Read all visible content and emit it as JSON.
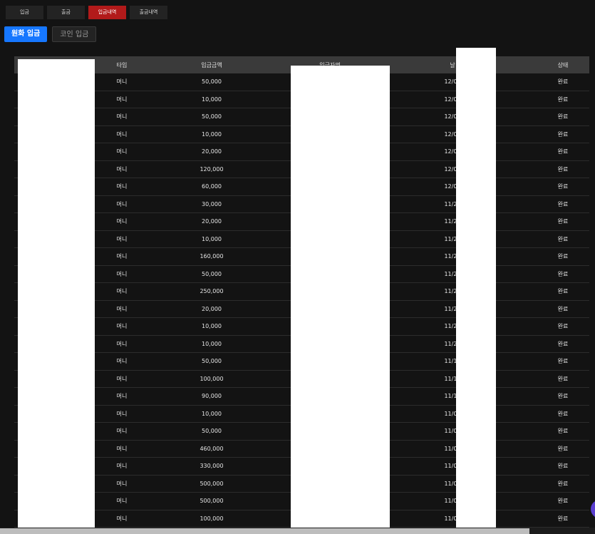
{
  "topnav": [
    {
      "label": "입금",
      "active": false
    },
    {
      "label": "출금",
      "active": false
    },
    {
      "label": "입금내역",
      "active": true
    },
    {
      "label": "출금내역",
      "active": false
    }
  ],
  "subtabs": {
    "primary": "원화 입금",
    "secondary": "코인 입금"
  },
  "table": {
    "headers": {
      "type": "타입",
      "amount": "입금금액",
      "depositor": "입금자명",
      "date": "날",
      "status": "상태"
    },
    "rows": [
      {
        "type": "머니",
        "amount": "50,000",
        "date": "12/01",
        "status": "완료"
      },
      {
        "type": "머니",
        "amount": "10,000",
        "date": "12/02",
        "status": "완료"
      },
      {
        "type": "머니",
        "amount": "50,000",
        "date": "12/02",
        "status": "완료"
      },
      {
        "type": "머니",
        "amount": "10,000",
        "date": "12/02",
        "status": "완료"
      },
      {
        "type": "머니",
        "amount": "20,000",
        "date": "12/01",
        "status": "완료"
      },
      {
        "type": "머니",
        "amount": "120,000",
        "date": "12/01",
        "status": "완료"
      },
      {
        "type": "머니",
        "amount": "60,000",
        "date": "12/01",
        "status": "완료"
      },
      {
        "type": "머니",
        "amount": "30,000",
        "date": "11/27",
        "status": "완료"
      },
      {
        "type": "머니",
        "amount": "20,000",
        "date": "11/27",
        "status": "완료"
      },
      {
        "type": "머니",
        "amount": "10,000",
        "date": "11/25",
        "status": "완료"
      },
      {
        "type": "머니",
        "amount": "160,000",
        "date": "11/25",
        "status": "완료"
      },
      {
        "type": "머니",
        "amount": "50,000",
        "date": "11/25",
        "status": "완료"
      },
      {
        "type": "머니",
        "amount": "250,000",
        "date": "11/25",
        "status": "완료"
      },
      {
        "type": "머니",
        "amount": "20,000",
        "date": "11/22",
        "status": "완료"
      },
      {
        "type": "머니",
        "amount": "10,000",
        "date": "11/21",
        "status": "완료"
      },
      {
        "type": "머니",
        "amount": "10,000",
        "date": "11/21",
        "status": "완료"
      },
      {
        "type": "머니",
        "amount": "50,000",
        "date": "11/18",
        "status": "완료"
      },
      {
        "type": "머니",
        "amount": "100,000",
        "date": "11/18",
        "status": "완료"
      },
      {
        "type": "머니",
        "amount": "90,000",
        "date": "11/18",
        "status": "완료"
      },
      {
        "type": "머니",
        "amount": "10,000",
        "date": "11/09",
        "status": "완료"
      },
      {
        "type": "머니",
        "amount": "50,000",
        "date": "11/09",
        "status": "완료"
      },
      {
        "type": "머니",
        "amount": "460,000",
        "date": "11/07",
        "status": "완료"
      },
      {
        "type": "머니",
        "amount": "330,000",
        "date": "11/07",
        "status": "완료"
      },
      {
        "type": "머니",
        "amount": "500,000",
        "date": "11/07",
        "status": "완료"
      },
      {
        "type": "머니",
        "amount": "500,000",
        "date": "11/07",
        "status": "완료"
      },
      {
        "type": "머니",
        "amount": "100,000",
        "date": "11/06",
        "status": "완료"
      }
    ]
  },
  "colors": {
    "background": "#131313",
    "active_tab": "#b21a1a",
    "primary_button": "#1677ff",
    "header_row": "#3a3a3a",
    "floating_button": "#5a3fd0"
  }
}
